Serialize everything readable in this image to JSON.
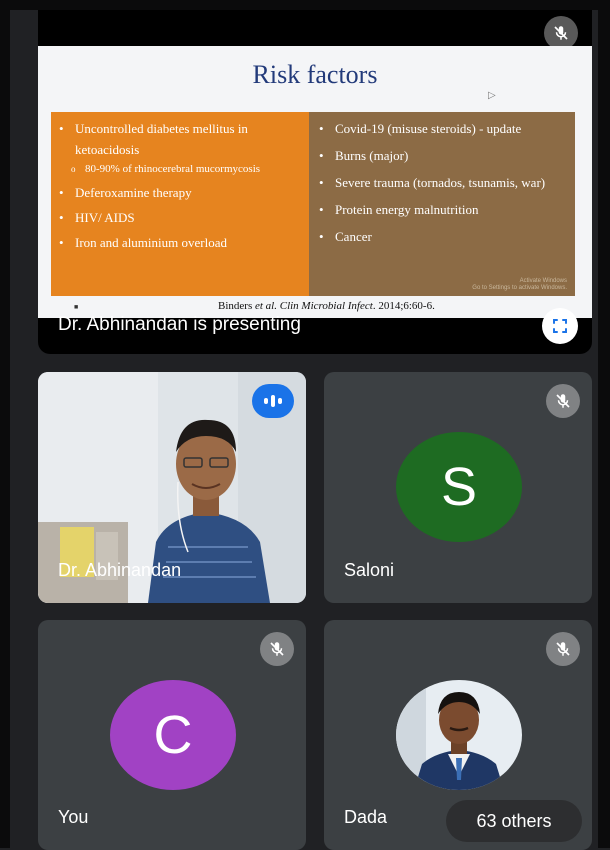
{
  "presentation": {
    "slide": {
      "title": "Risk factors",
      "left_items": [
        "Uncontrolled diabetes mellitus in ketoacidosis",
        "80-90% of rhinocerebral mucormycosis",
        "Deferoxamine therapy",
        "HIV/ AIDS",
        "Iron and aluminium overload"
      ],
      "right_items": [
        "Covid-19 (misuse steroids) - update",
        "Burns (major)",
        "Severe trauma (tornados, tsunamis, war)",
        "Protein energy malnutrition",
        "Cancer"
      ],
      "citation_prefix": "Binders ",
      "citation_italic": "et al. Clin Microbial Infect",
      "citation_suffix": ". 2014;6:60-6.",
      "watermark_line1": "Activate Windows",
      "watermark_line2": "Go to Settings to activate Windows."
    },
    "presenter_label": "Dr. Abhinandan is presenting"
  },
  "participants": [
    {
      "name": "Dr. Abhinandan",
      "state": "speaking"
    },
    {
      "name": "Saloni",
      "initial": "S",
      "avatar_color": "#1e6b22",
      "muted": true
    },
    {
      "name": "You",
      "initial": "C",
      "avatar_color": "#a142c4",
      "muted": true
    },
    {
      "name": "Dada",
      "muted": true
    }
  ],
  "others_label": "63 others",
  "colors": {
    "background": "#202124",
    "tile": "#3c4043",
    "speaking_badge": "#1a73e8",
    "slide_left_box": "#e6841f",
    "slide_right_box": "#8c6b45",
    "slide_title": "#223a7a"
  },
  "icons": {
    "mute": "mic-off-icon",
    "fullscreen": "fullscreen-icon",
    "speaking": "audio-level-icon"
  }
}
